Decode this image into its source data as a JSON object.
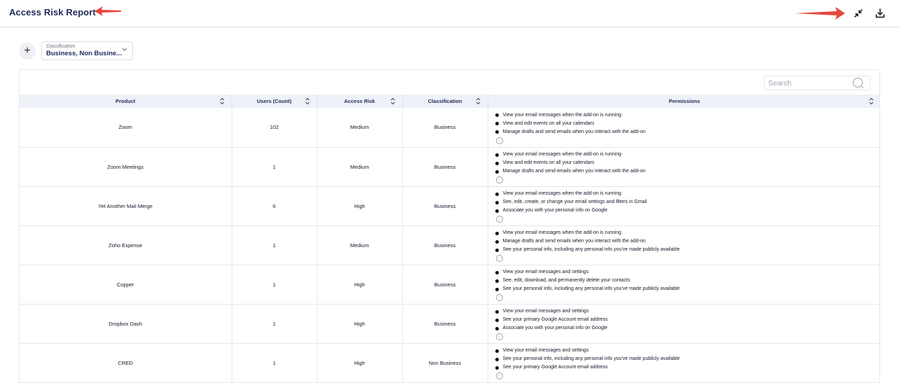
{
  "header": {
    "title": "Access Risk Report"
  },
  "colors": {
    "annotation_arrow": "#e8473c",
    "title": "#1f2a5a",
    "table_header_bg": "#eef2f8"
  },
  "filter": {
    "label": "Classification",
    "value": "Business, Non Busine..."
  },
  "search": {
    "placeholder": "Search"
  },
  "table": {
    "columns": [
      "Product",
      "Users (Count)",
      "Access Risk",
      "Classification",
      "Permissions"
    ],
    "rows": [
      {
        "product": "Zoom",
        "users": "102",
        "risk": "Medium",
        "classification": "Business",
        "permissions": [
          "View your email messages when the add-on is running",
          "View and edit events on all your calendars",
          "Manage drafts and send emails when you interact with the add-on"
        ]
      },
      {
        "product": "Zoom Meetings",
        "users": "1",
        "risk": "Medium",
        "classification": "Business",
        "permissions": [
          "View your email messages when the add-on is running",
          "View and edit events on all your calendars",
          "Manage drafts and send emails when you interact with the add-on"
        ]
      },
      {
        "product": "Yet Another Mail Merge",
        "users": "6",
        "risk": "High",
        "classification": "Business",
        "permissions": [
          "View your email messages when the add-on is running",
          "See, edit, create, or change your email settings and filters in Gmail",
          "Associate you with your personal info on Google"
        ]
      },
      {
        "product": "Zoho Expense",
        "users": "1",
        "risk": "Medium",
        "classification": "Business",
        "permissions": [
          "View your email messages when the add-on is running",
          "Manage drafts and send emails when you interact with the add-on",
          "See your personal info, including any personal info you've made publicly available"
        ]
      },
      {
        "product": "Copper",
        "users": "1",
        "risk": "High",
        "classification": "Business",
        "permissions": [
          "View your email messages and settings",
          "See, edit, download, and permanently delete your contacts",
          "See your personal info, including any personal info you've made publicly available"
        ]
      },
      {
        "product": "Dropbox Dash",
        "users": "1",
        "risk": "High",
        "classification": "Business",
        "permissions": [
          "View your email messages and settings",
          "See your primary Google Account email address",
          "Associate you with your personal info on Google"
        ]
      },
      {
        "product": "CRED",
        "users": "1",
        "risk": "High",
        "classification": "Non Business",
        "permissions": [
          "View your email messages and settings",
          "See your personal info, including any personal info you've made publicly available",
          "See your primary Google Account email address"
        ]
      }
    ]
  }
}
